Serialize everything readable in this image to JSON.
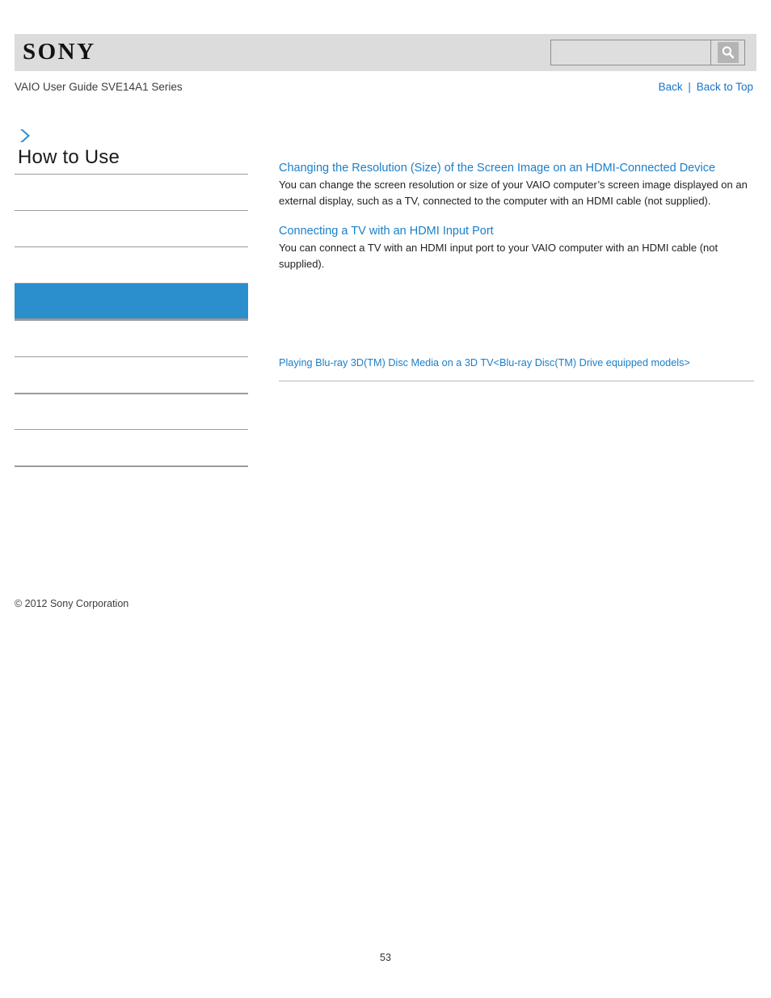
{
  "header": {
    "logo_text": "SONY",
    "search": {
      "value": "",
      "placeholder": "",
      "icon": "search-icon",
      "button_label": ""
    }
  },
  "subheader": {
    "guide_title": "VAIO User Guide SVE14A1 Series",
    "nav": {
      "back_label": "Back",
      "separator": "|",
      "back_to_top_label": "Back to Top"
    }
  },
  "sidebar": {
    "breadcrumb_icon": "chevron-right-icon",
    "heading": "How to Use",
    "items": [
      {
        "label": "",
        "selected": false,
        "thick": false
      },
      {
        "label": "",
        "selected": false,
        "thick": false
      },
      {
        "label": "",
        "selected": false,
        "thick": false
      },
      {
        "label": "",
        "selected": true,
        "thick": false
      },
      {
        "label": "",
        "selected": false,
        "thick": false
      },
      {
        "label": "",
        "selected": false,
        "thick": false
      },
      {
        "label": "",
        "selected": false,
        "thick": true
      },
      {
        "label": "",
        "selected": false,
        "thick": false
      }
    ]
  },
  "content": {
    "topics": [
      {
        "link": "Changing the Resolution (Size) of the Screen Image on an HDMI-Connected Device",
        "description": "You can change the screen resolution or size of your VAIO computer’s screen image displayed on an external display, such as a TV, connected to the computer with an HDMI cable (not supplied)."
      },
      {
        "link": "Connecting a TV with an HDMI Input Port",
        "description": "You can connect a TV with an HDMI input port to your VAIO computer with an HDMI cable (not supplied)."
      }
    ],
    "secondary_link": "Playing Blu-ray 3D(TM) Disc Media on a 3D TV<Blu-ray Disc(TM) Drive equipped models>"
  },
  "footer": {
    "copyright": "© 2012 Sony Corporation",
    "page_number": "53"
  },
  "colors": {
    "header_band": "#dcdcdc",
    "link_blue": "#1a7fc9",
    "nav_blue": "#1a73c4",
    "selected_item": "#2b8fce",
    "rule_gray": "#9a9a9a"
  }
}
